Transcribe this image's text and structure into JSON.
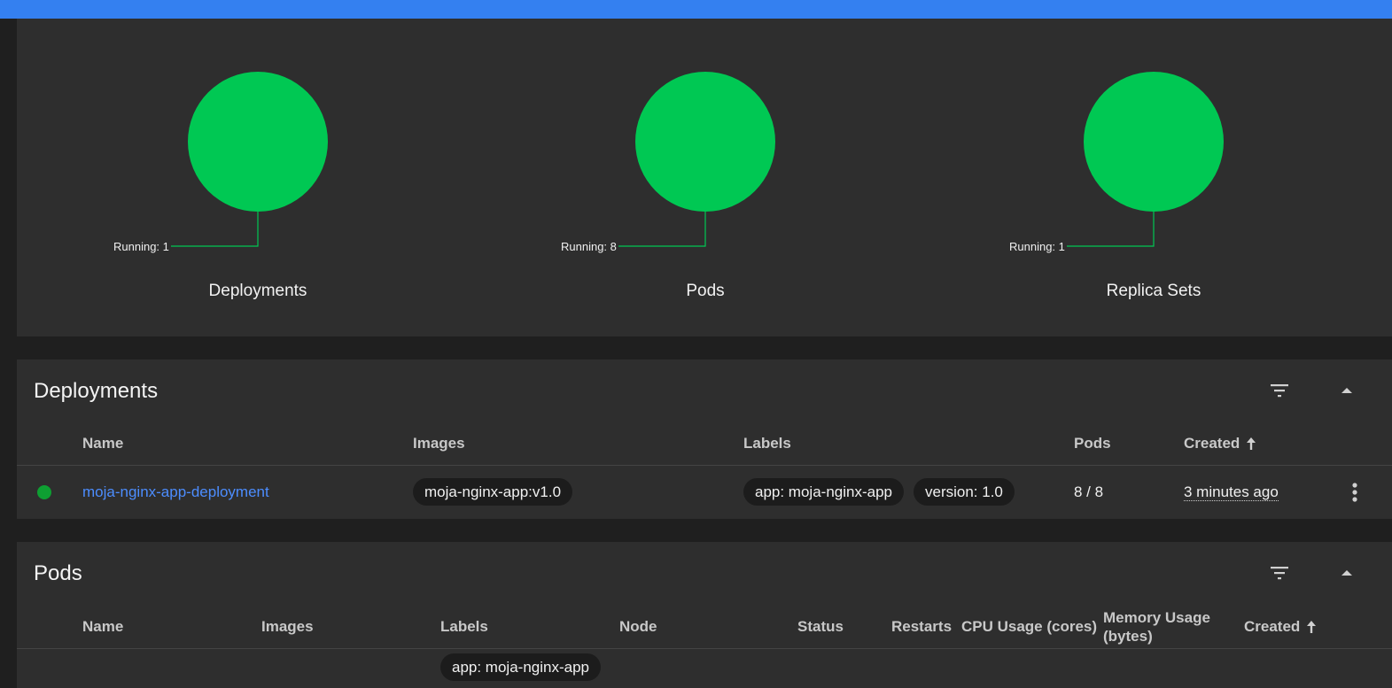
{
  "summary": {
    "charts": [
      {
        "title": "Deployments",
        "legend_label": "Running: 1",
        "running": 1
      },
      {
        "title": "Pods",
        "legend_label": "Running: 8",
        "running": 8
      },
      {
        "title": "Replica Sets",
        "legend_label": "Running: 1",
        "running": 1
      }
    ],
    "colors": {
      "running": "#00c853"
    }
  },
  "deployments": {
    "title": "Deployments",
    "headers": {
      "name": "Name",
      "images": "Images",
      "labels": "Labels",
      "pods": "Pods",
      "created": "Created"
    },
    "rows": [
      {
        "status": "running",
        "name": "moja-nginx-app-deployment",
        "image": "moja-nginx-app:v1.0",
        "labels": [
          "app: moja-nginx-app",
          "version: 1.0"
        ],
        "pods": "8 / 8",
        "created": "3 minutes ago"
      }
    ]
  },
  "pods": {
    "title": "Pods",
    "headers": {
      "name": "Name",
      "images": "Images",
      "labels": "Labels",
      "node": "Node",
      "status": "Status",
      "restarts": "Restarts",
      "cpu": "CPU Usage (cores)",
      "memory_line1": "Memory Usage",
      "memory_line2": "(bytes)",
      "created": "Created"
    },
    "rows": [
      {
        "labels": [
          "app: moja-nginx-app"
        ]
      }
    ]
  },
  "icons": {
    "filter": "filter-icon",
    "collapse": "chevron-up-icon",
    "sort": "arrow-up-icon",
    "more": "more-vert-icon"
  }
}
